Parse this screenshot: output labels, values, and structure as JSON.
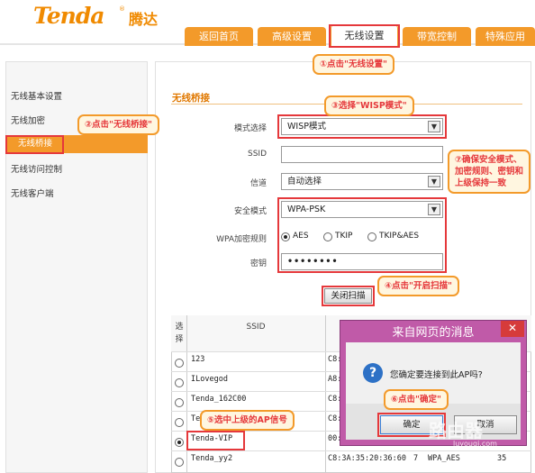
{
  "header": {
    "logo": "Tenda",
    "logo_cn": "腾达",
    "logo_mark": "®",
    "tabs": [
      "返回首页",
      "高级设置",
      "无线设置",
      "带宽控制",
      "特殊应用"
    ]
  },
  "sidebar": {
    "items": [
      "无线基本设置",
      "无线加密",
      "无线桥接",
      "无线访问控制",
      "无线客户端"
    ]
  },
  "main": {
    "section_title": "无线桥接",
    "mode_label": "模式选择",
    "mode_value": "WISP模式",
    "ssid_label": "SSID",
    "ssid_value": "",
    "channel_label": "信道",
    "channel_value": "自动选择",
    "security_label": "安全模式",
    "security_value": "WPA-PSK",
    "wpa_rule_label": "WPA加密规则",
    "wpa_options": [
      "AES",
      "TKIP",
      "TKIP&AES"
    ],
    "key_label": "密钥",
    "key_value": "••••••••",
    "scan_button": "关闭扫描"
  },
  "table": {
    "col_select": "选\n择",
    "col_ssid": "SSID",
    "rows": [
      {
        "ssid": "123",
        "mac": "C8:",
        "ch": "",
        "sec": "",
        "sig": ""
      },
      {
        "ssid": "ILovegod",
        "mac": "A8:",
        "ch": "",
        "sec": "",
        "sig": ""
      },
      {
        "ssid": "Tenda_162C00",
        "mac": "C8:",
        "ch": "",
        "sec": "",
        "sig": ""
      },
      {
        "ssid": "Ter",
        "mac": "C8:",
        "ch": "",
        "sec": "",
        "sig": ""
      },
      {
        "ssid": "Tenda-VIP",
        "mac": "00:",
        "ch": "",
        "sec": "",
        "sig": ""
      },
      {
        "ssid": "Tenda_yy2",
        "mac": "C8:3A:35:20:36:60",
        "ch": "7",
        "sec": "WPA_AES",
        "sig": "35"
      }
    ]
  },
  "dialog": {
    "title": "来自网页的消息",
    "close": "✕",
    "message": "您确定要连接到此AP吗?",
    "ok": "确定",
    "cancel": "取消"
  },
  "annotations": {
    "a1": "①点击\"无线设置\"",
    "a2": "②点击\"无线桥接\"",
    "a3": "③选择\"WISP模式\"",
    "a4": "④点击\"开启扫描\"",
    "a5": "⑤选中上级的AP信号",
    "a6": "⑥点击\"确定\"",
    "a7": "⑦确保安全模式、加密规则、密钥和上级保持一致"
  },
  "watermark": {
    "main": "路由器",
    "sub": "luyouqi.com"
  },
  "colors": {
    "accent": "#f39a2a",
    "annotation": "#e5383b",
    "dialog": "#c05aa8"
  }
}
